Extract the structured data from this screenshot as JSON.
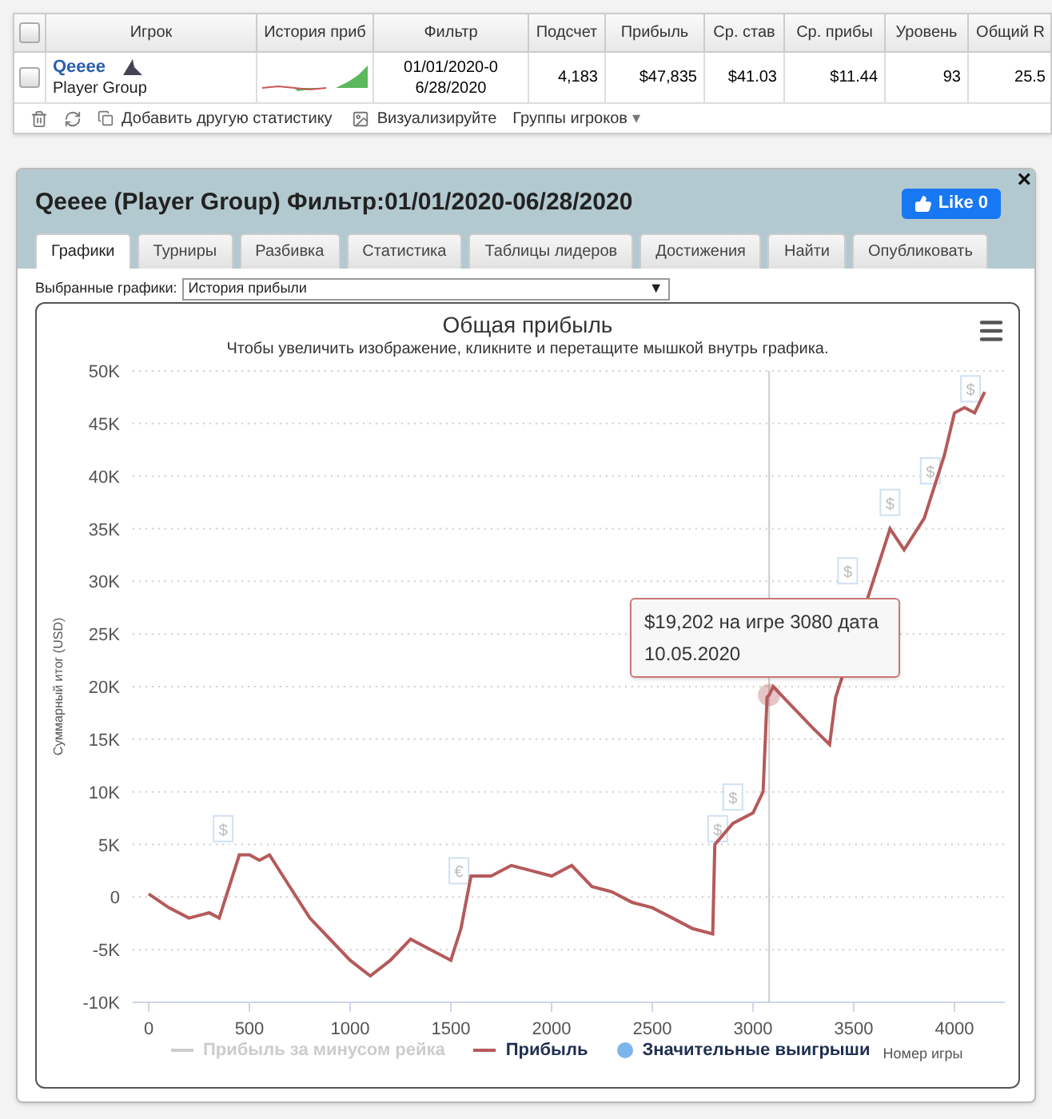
{
  "stats_table": {
    "columns": [
      "Игрок",
      "История приб",
      "Фильтр",
      "Подсчет",
      "Прибыль",
      "Ср. став",
      "Ср. прибы",
      "Уровень",
      "Общий R"
    ],
    "header_checked": false,
    "rows": [
      {
        "checked": false,
        "player": "Qeeee",
        "group": "Player Group",
        "filter": "01/01/2020-06/28/2020",
        "count": "4,183",
        "profit": "$47,835",
        "avg_stake": "$41.03",
        "avg_profit": "$11.44",
        "level": "93",
        "total": "25.5"
      }
    ],
    "toolbar": [
      "Добавить другую статистику",
      "Визуализируйте",
      "Группы игроков"
    ],
    "toolbar_caret": "▾"
  },
  "panel": {
    "title": "Qeeee (Player Group) Фильтр:01/01/2020-06/28/2020",
    "like_button": "Like 0",
    "close": "×",
    "tabs": [
      {
        "label": "Графики",
        "selected": true
      },
      {
        "label": "Турниры",
        "selected": false
      },
      {
        "label": "Разбивка",
        "selected": false
      },
      {
        "label": "Статистика",
        "selected": false
      },
      {
        "label": "Таблицы лидеров",
        "selected": false
      },
      {
        "label": "Достижения",
        "selected": false
      },
      {
        "label": "Найти",
        "selected": false
      },
      {
        "label": "Опубликовать",
        "selected": false
      }
    ],
    "chart_select": {
      "label": "Выбранные графики:",
      "value": "История прибыли",
      "arrow": "▼"
    },
    "chart": {
      "subtitle": "Чтобы увеличить изображение, кликните и перетащите мышкой внутрь графика.",
      "tooltip": "$19,202 на игре 3080 дата 10.05.2020",
      "win_flags": [
        "$",
        "€",
        "$",
        "$",
        "$",
        "$",
        "$",
        "$"
      ],
      "legend": [
        {
          "label": "Прибыль за минусом рейка",
          "enabled": false,
          "kind": "line"
        },
        {
          "kind": "series",
          "enabled": true
        },
        {
          "label": "Значительные выигрыши",
          "enabled": true,
          "kind": "dot",
          "color": "#7cb5ec"
        }
      ],
      "chart_data": {
        "type": "line",
        "title": "Общая прибыль",
        "xlabel": "Номер игры",
        "ylabel": "Суммарный итог (USD)",
        "grid": true,
        "x": [
          0,
          100,
          200,
          300,
          350,
          400,
          450,
          500,
          550,
          600,
          700,
          800,
          900,
          1000,
          1100,
          1200,
          1300,
          1400,
          1500,
          1550,
          1600,
          1700,
          1800,
          1900,
          2000,
          2100,
          2200,
          2300,
          2400,
          2500,
          2600,
          2700,
          2800,
          2810,
          2900,
          3000,
          3050,
          3070,
          3080,
          3100,
          3200,
          3300,
          3380,
          3410,
          3680,
          3750,
          3850,
          3950,
          4000,
          4050,
          4100,
          4150
        ],
        "series": [
          {
            "name": "Прибыль",
            "color": "#b55a5a",
            "values": [
              0.3,
              -1,
              -2,
              -1.5,
              -2,
              1,
              4,
              4,
              3.5,
              4,
              1,
              -2,
              -4,
              -6,
              -7.5,
              -6,
              -4,
              -5,
              -6,
              -3,
              2,
              2,
              3,
              2.5,
              2,
              3,
              1,
              0.5,
              -0.5,
              -1,
              -2,
              -3,
              -3.5,
              5,
              7,
              8,
              10,
              19,
              19.2,
              20,
              18,
              16,
              14.5,
              19,
              35,
              33,
              36,
              42,
              46,
              46.5,
              46,
              48
            ]
          }
        ],
        "xlim": [
          -80,
          4250
        ],
        "ylim": [
          -10,
          50
        ],
        "xticks": [
          0,
          500,
          1000,
          1500,
          2000,
          2500,
          3000,
          3500,
          4000
        ],
        "yticks": [
          {
            "value": -10,
            "label": "-10K"
          },
          {
            "value": -5,
            "label": "-5K"
          },
          {
            "value": 0,
            "label": "0"
          },
          {
            "value": 5,
            "label": "5K"
          },
          {
            "value": 10,
            "label": "10K"
          },
          {
            "value": 15,
            "label": "15K"
          },
          {
            "value": 20,
            "label": "20K"
          },
          {
            "value": 25,
            "label": "25K"
          },
          {
            "value": 30,
            "label": "30K"
          },
          {
            "value": 35,
            "label": "35K"
          },
          {
            "value": 40,
            "label": "40K"
          },
          {
            "value": 45,
            "label": "45K"
          },
          {
            "value": 50,
            "label": "50K"
          }
        ],
        "ref_lines": [
          {
            "axis": "x",
            "value": 3080
          }
        ]
      }
    }
  }
}
